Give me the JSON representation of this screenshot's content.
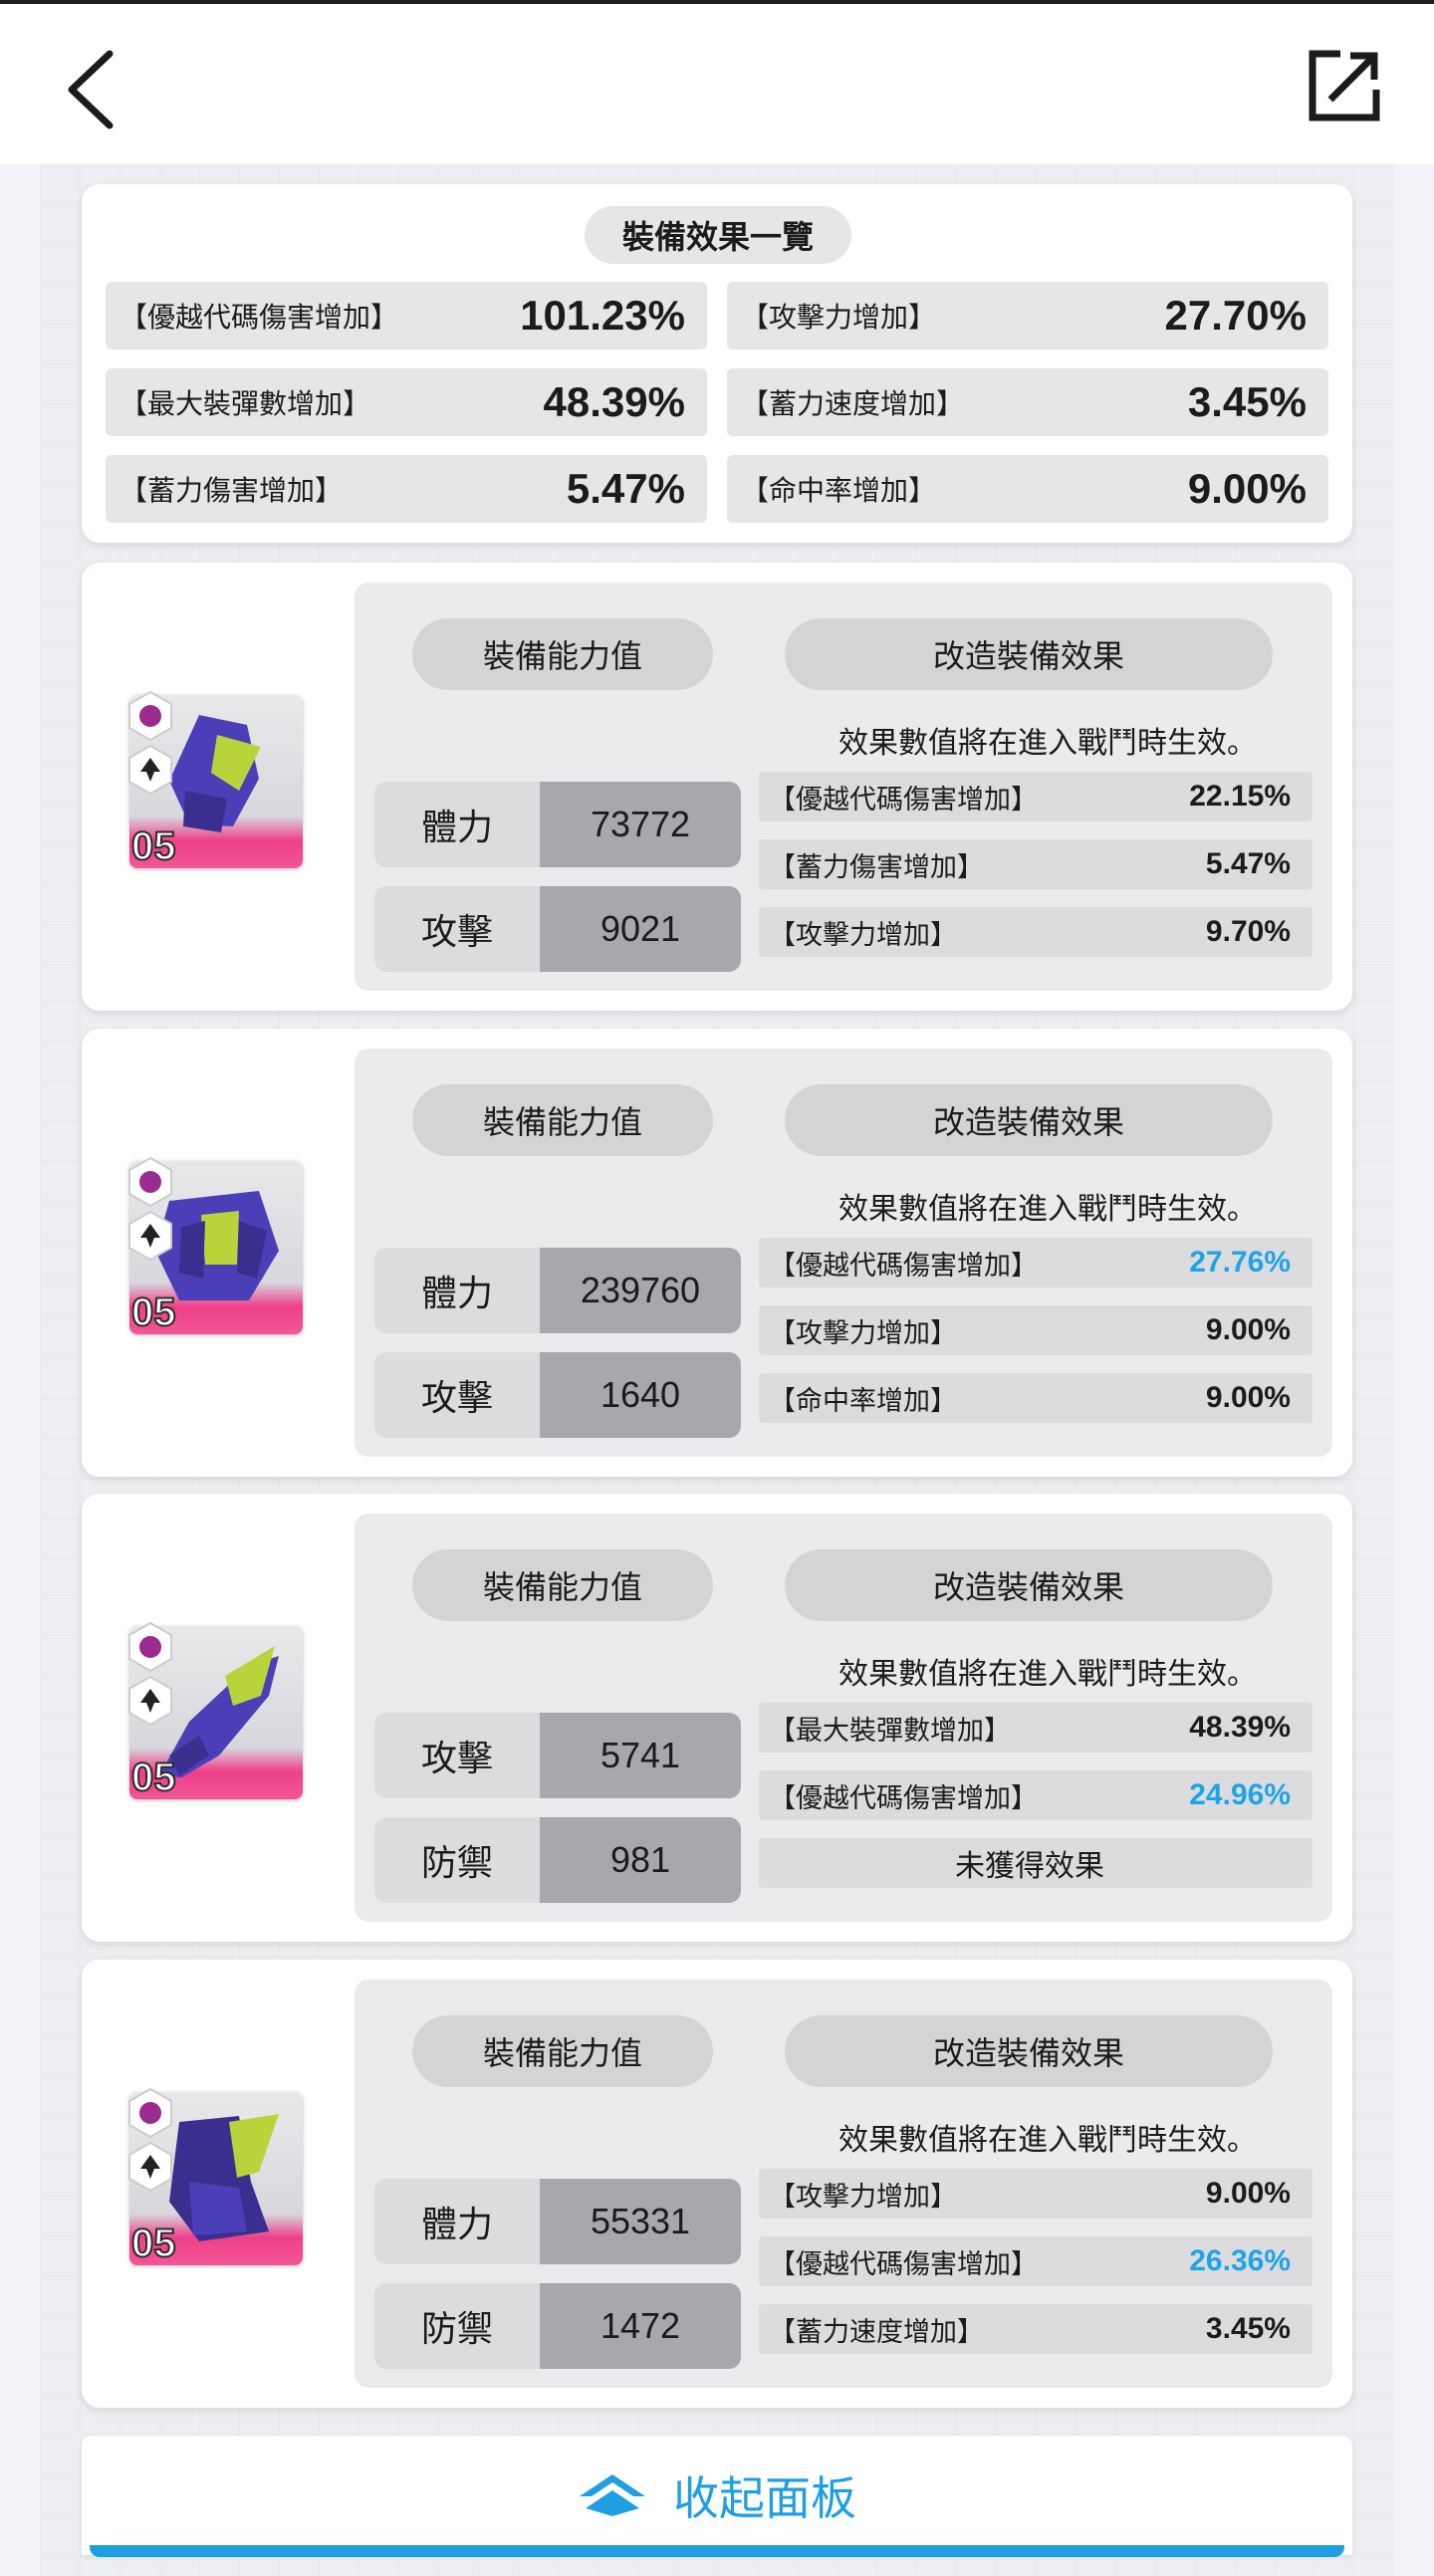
{
  "summary": {
    "title": "裝備效果一覽",
    "items": [
      {
        "label": "【優越代碼傷害增加】",
        "value": "101.23%"
      },
      {
        "label": "【攻擊力增加】",
        "value": "27.70%"
      },
      {
        "label": "【最大裝彈數增加】",
        "value": "48.39%"
      },
      {
        "label": "【蓄力速度增加】",
        "value": "3.45%"
      },
      {
        "label": "【蓄力傷害增加】",
        "value": "5.47%"
      },
      {
        "label": "【命中率增加】",
        "value": "9.00%"
      }
    ]
  },
  "ability_label": "裝備能力值",
  "mod_label": "改造裝備效果",
  "note": "效果數值將在進入戰鬥時生效。",
  "equipment": [
    {
      "level": "05",
      "stats": [
        {
          "label": "體力",
          "value": "73772"
        },
        {
          "label": "攻擊",
          "value": "9021"
        }
      ],
      "effects": [
        {
          "label": "【優越代碼傷害增加】",
          "value": "22.15%",
          "highlight": false
        },
        {
          "label": "【蓄力傷害增加】",
          "value": "5.47%",
          "highlight": false
        },
        {
          "label": "【攻擊力增加】",
          "value": "9.70%",
          "highlight": false
        }
      ]
    },
    {
      "level": "05",
      "stats": [
        {
          "label": "體力",
          "value": "239760"
        },
        {
          "label": "攻擊",
          "value": "1640"
        }
      ],
      "effects": [
        {
          "label": "【優越代碼傷害增加】",
          "value": "27.76%",
          "highlight": true
        },
        {
          "label": "【攻擊力增加】",
          "value": "9.00%",
          "highlight": false
        },
        {
          "label": "【命中率增加】",
          "value": "9.00%",
          "highlight": false
        }
      ]
    },
    {
      "level": "05",
      "stats": [
        {
          "label": "攻擊",
          "value": "5741"
        },
        {
          "label": "防禦",
          "value": "981"
        }
      ],
      "effects": [
        {
          "label": "【最大裝彈數增加】",
          "value": "48.39%",
          "highlight": false
        },
        {
          "label": "【優越代碼傷害增加】",
          "value": "24.96%",
          "highlight": true
        },
        {
          "label": "未獲得效果",
          "value": "",
          "highlight": false
        }
      ]
    },
    {
      "level": "05",
      "stats": [
        {
          "label": "體力",
          "value": "55331"
        },
        {
          "label": "防禦",
          "value": "1472"
        }
      ],
      "effects": [
        {
          "label": "【攻擊力增加】",
          "value": "9.00%",
          "highlight": false
        },
        {
          "label": "【優越代碼傷害增加】",
          "value": "26.36%",
          "highlight": true
        },
        {
          "label": "【蓄力速度增加】",
          "value": "3.45%",
          "highlight": false
        }
      ]
    }
  ],
  "collapse_label": "收起面板",
  "colors": {
    "accent": "#1e9fe2",
    "highlight": "#1ea4e6",
    "pink": "#f25695",
    "purple": "#9b2b8e"
  },
  "icons": {
    "back": "chevron-left-icon",
    "share": "external-link-icon",
    "collapse": "chevron-up-icon"
  }
}
